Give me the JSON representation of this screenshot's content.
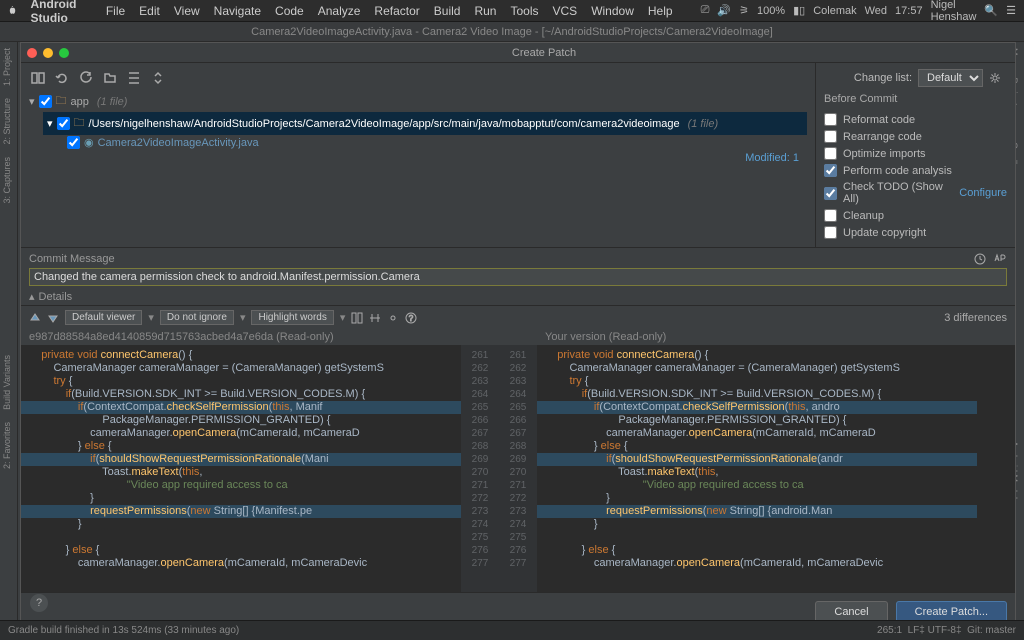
{
  "menubar": {
    "app": "Android Studio",
    "items": [
      "File",
      "Edit",
      "View",
      "Navigate",
      "Code",
      "Analyze",
      "Refactor",
      "Build",
      "Run",
      "Tools",
      "VCS",
      "Window",
      "Help"
    ],
    "battery": "100%",
    "kb": "Colemak",
    "day": "Wed",
    "time": "17:57",
    "user": "Nigel Henshaw"
  },
  "titlebar": "Camera2VideoImageActivity.java - Camera2 Video Image - [~/AndroidStudioProjects/Camera2VideoImage]",
  "dialog": {
    "title": "Create Patch"
  },
  "change_list_label": "Change list:",
  "change_list_value": "Default",
  "before_commit_label": "Before Commit",
  "opts": {
    "reformat": "Reformat code",
    "rearrange": "Rearrange code",
    "optimize": "Optimize imports",
    "analysis": "Perform code analysis",
    "todo": "Check TODO (Show All)",
    "configure": "Configure",
    "cleanup": "Cleanup",
    "copyright": "Update copyright"
  },
  "tree": {
    "root": "app",
    "root_count": "(1 file)",
    "path": "/Users/nigelhenshaw/AndroidStudioProjects/Camera2VideoImage/app/src/main/java/mobapptut/com/camera2videoimage",
    "path_count": "(1 file)",
    "file": "Camera2VideoImageActivity.java"
  },
  "modified": "Modified: 1",
  "commit_msg_label": "Commit Message",
  "commit_msg_value": "Changed the camera permission check to android.Manifest.permission.Camera",
  "details_label": "Details",
  "diff_toolbar": {
    "viewer": "Default viewer",
    "ignore": "Do not ignore",
    "highlight": "Highlight words"
  },
  "diff_count": "3 differences",
  "diff_headers": {
    "left": "e987d88584a8ed4140859d715763acbed4a7e6da (Read-only)",
    "right": "Your version (Read-only)"
  },
  "line_numbers": [
    261,
    262,
    263,
    264,
    265,
    266,
    267,
    268,
    269,
    270,
    271,
    272,
    273,
    274,
    275,
    276,
    277
  ],
  "buttons": {
    "cancel": "Cancel",
    "create": "Create Patch..."
  },
  "statusbar": {
    "left": "Gradle build finished in 13s 524ms (33 minutes ago)",
    "pos": "265:1",
    "enc": "LF‡  UTF-8‡",
    "git": "Git: master"
  },
  "left_rail": [
    "1: Project",
    "2: Structure",
    "3: Captures",
    "Build Variants",
    "2: Favorites"
  ],
  "right_rail": [
    "Maven Projects",
    "Gradle",
    "Android Model"
  ],
  "code_left": [
    {
      "t": "    private void connectCamera() {",
      "c": "kw"
    },
    {
      "t": "        CameraManager cameraManager = (CameraManager) getSystemS"
    },
    {
      "t": "        try {"
    },
    {
      "t": "            if(Build.VERSION.SDK_INT >= Build.VERSION_CODES.M) {"
    },
    {
      "t": "                if(ContextCompat.checkSelfPermission(this, Manif",
      "hl": true
    },
    {
      "t": "                        PackageManager.PERMISSION_GRANTED) {"
    },
    {
      "t": "                    cameraManager.openCamera(mCameraId, mCameraD"
    },
    {
      "t": "                } else {"
    },
    {
      "t": "                    if(shouldShowRequestPermissionRationale(Mani",
      "hl": true
    },
    {
      "t": "                        Toast.makeText(this,"
    },
    {
      "t": "                                \"Video app required access to ca",
      "str": true
    },
    {
      "t": "                    }"
    },
    {
      "t": "                    requestPermissions(new String[] {Manifest.pe",
      "hl": true
    },
    {
      "t": "                }"
    },
    {
      "t": ""
    },
    {
      "t": "            } else {"
    },
    {
      "t": "                cameraManager.openCamera(mCameraId, mCameraDevic"
    }
  ],
  "code_right": [
    {
      "t": "    private void connectCamera() {"
    },
    {
      "t": "        CameraManager cameraManager = (CameraManager) getSystemS"
    },
    {
      "t": "        try {"
    },
    {
      "t": "            if(Build.VERSION.SDK_INT >= Build.VERSION_CODES.M) {"
    },
    {
      "t": "                if(ContextCompat.checkSelfPermission(this, andro",
      "hl": true
    },
    {
      "t": "                        PackageManager.PERMISSION_GRANTED) {"
    },
    {
      "t": "                    cameraManager.openCamera(mCameraId, mCameraD"
    },
    {
      "t": "                } else {"
    },
    {
      "t": "                    if(shouldShowRequestPermissionRationale(andr",
      "hl": true
    },
    {
      "t": "                        Toast.makeText(this,"
    },
    {
      "t": "                                \"Video app required access to ca",
      "str": true
    },
    {
      "t": "                    }"
    },
    {
      "t": "                    requestPermissions(new String[] {android.Man",
      "hl": true
    },
    {
      "t": "                }"
    },
    {
      "t": ""
    },
    {
      "t": "            } else {"
    },
    {
      "t": "                cameraManager.openCamera(mCameraId, mCameraDevic"
    }
  ]
}
